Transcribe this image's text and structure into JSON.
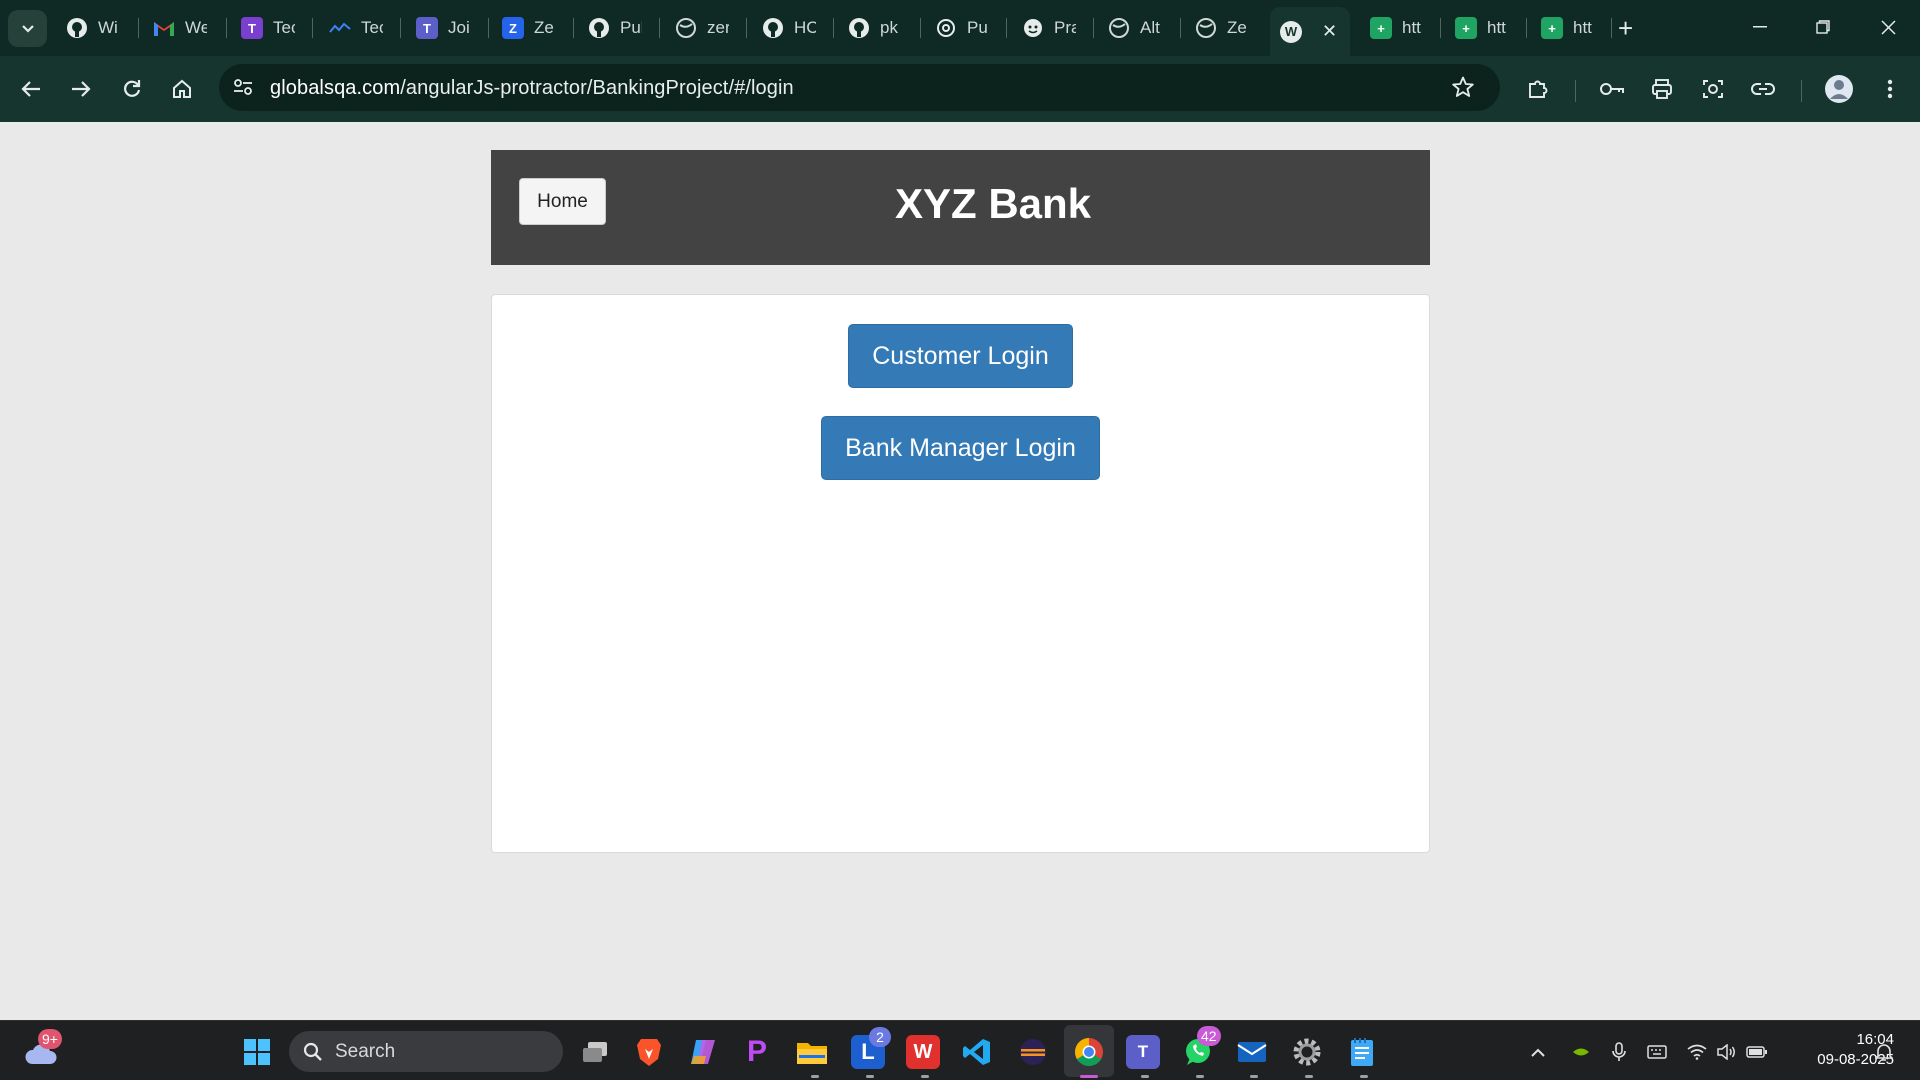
{
  "browser": {
    "tabs": [
      {
        "title": "Wi",
        "icon": "github-icon"
      },
      {
        "title": "We",
        "icon": "gmail-icon"
      },
      {
        "title": "Tec",
        "icon": "testing-app-icon"
      },
      {
        "title": "Tec",
        "icon": "chart-line-icon"
      },
      {
        "title": "Joi",
        "icon": "teams-icon"
      },
      {
        "title": "Ze",
        "icon": "zephyr-icon"
      },
      {
        "title": "Pul",
        "icon": "github-icon"
      },
      {
        "title": "zer",
        "icon": "globe-icon"
      },
      {
        "title": "HC",
        "icon": "github-icon"
      },
      {
        "title": "pk",
        "icon": "github-icon"
      },
      {
        "title": "Pu",
        "icon": "openai-icon"
      },
      {
        "title": "Pra",
        "icon": "face-icon"
      },
      {
        "title": "Alt",
        "icon": "globe-icon"
      },
      {
        "title": "Ze",
        "icon": "globe-icon"
      },
      {
        "title": "",
        "icon": "wordpress-icon",
        "active": true
      },
      {
        "title": "htt",
        "icon": "sheets-icon"
      },
      {
        "title": "htt",
        "icon": "sheets-icon"
      },
      {
        "title": "htt",
        "icon": "sheets-icon"
      }
    ],
    "new_tab_symbol": "+",
    "url_host": "globalsqa.com",
    "url_path": "/angularJs-protractor/BankingProject/#/login"
  },
  "page": {
    "home_label": "Home",
    "title": "XYZ Bank",
    "customer_login_label": "Customer Login",
    "manager_login_label": "Bank Manager Login"
  },
  "taskbar": {
    "search_label": "Search",
    "weather_badge": "9+",
    "apps": [
      {
        "name": "task-view"
      },
      {
        "name": "brave"
      },
      {
        "name": "copilot"
      },
      {
        "name": "picsart"
      },
      {
        "name": "file-explorer"
      },
      {
        "name": "learning-app",
        "badge": "2"
      },
      {
        "name": "wps-office"
      },
      {
        "name": "vs-code"
      },
      {
        "name": "eclipse"
      },
      {
        "name": "chrome",
        "active": true
      },
      {
        "name": "teams"
      },
      {
        "name": "whatsapp",
        "badge": "42"
      },
      {
        "name": "mail"
      },
      {
        "name": "settings"
      },
      {
        "name": "notepad"
      }
    ],
    "time": "16:04",
    "date": "09-08-2025"
  },
  "colors": {
    "tabstrip": "#0f2a24",
    "toolbar": "#17352f",
    "header": "#444343",
    "primary_button": "#337ab7",
    "taskbar": "#1f2022"
  }
}
